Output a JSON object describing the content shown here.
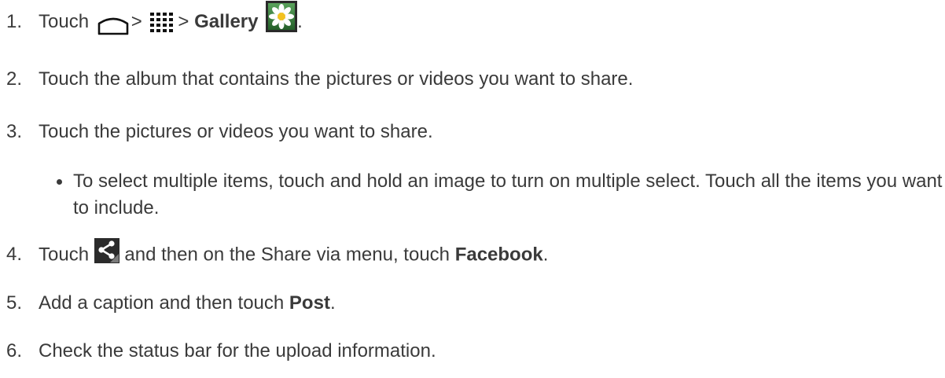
{
  "steps": [
    {
      "number": "1.",
      "parts": [
        "Touch",
        ">",
        ">",
        "Gallery",
        "."
      ],
      "icons": [
        "home-icon",
        "apps-grid-icon",
        "gallery-app-icon"
      ]
    },
    {
      "number": "2.",
      "text": "Touch the album that contains the pictures or videos you want to share."
    },
    {
      "number": "3.",
      "text": "Touch the pictures or videos you want to share.",
      "bullet": "To select multiple items, touch and hold an image to turn on multiple select. Touch all the items you want to include."
    },
    {
      "number": "4.",
      "parts": [
        "Touch",
        "and then on the Share via menu, touch",
        "Facebook",
        "."
      ],
      "icons": [
        "share-icon"
      ]
    },
    {
      "number": "5.",
      "parts": [
        "Add a caption and then touch",
        "Post",
        "."
      ]
    },
    {
      "number": "6.",
      "text": "Check the status bar for the upload information."
    }
  ],
  "colors": {
    "text": "#3a3a3a",
    "icon_green": "#2f7a34",
    "share_icon_bg": "#2b2b2b"
  }
}
